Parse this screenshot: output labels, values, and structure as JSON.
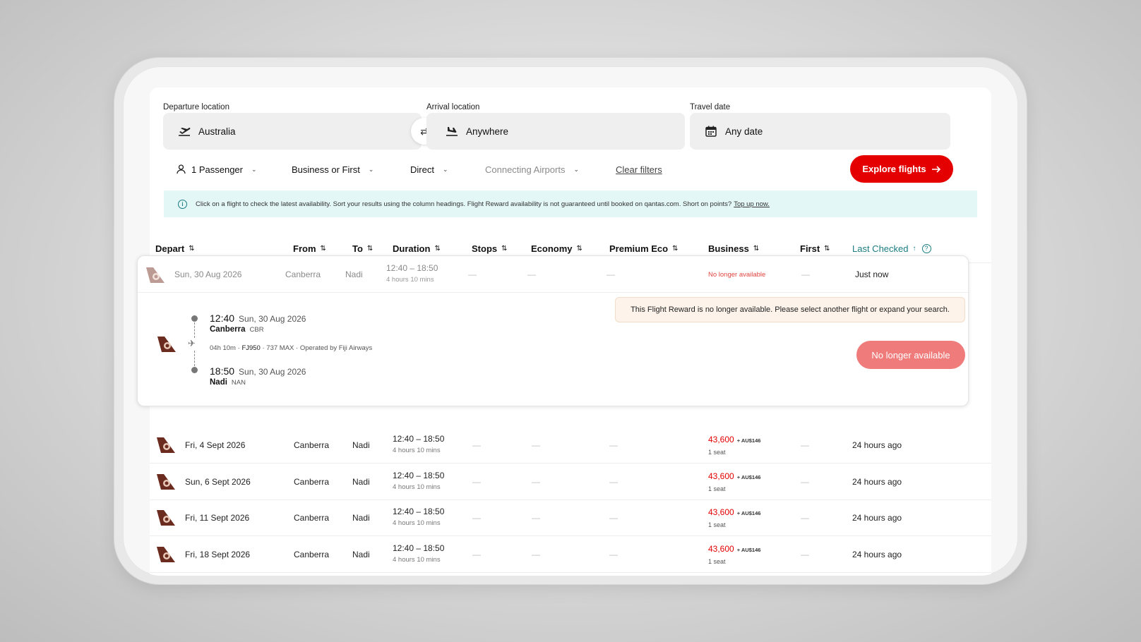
{
  "search": {
    "departure_label": "Departure location",
    "departure_value": "Australia",
    "arrival_label": "Arrival location",
    "arrival_value": "Anywhere",
    "date_label": "Travel date",
    "date_value": "Any date"
  },
  "filters": {
    "passengers": "1 Passenger",
    "cabin": "Business or First",
    "stops": "Direct",
    "connecting": "Connecting Airports",
    "clear": "Clear filters",
    "explore": "Explore flights"
  },
  "banner": {
    "text": "Click on a flight to check the latest availability. Sort your results using the column headings. Flight Reward availability is not guaranteed until booked on qantas.com. Short on points?",
    "link": "Top up now."
  },
  "columns": {
    "depart": "Depart",
    "from": "From",
    "to": "To",
    "duration": "Duration",
    "stops": "Stops",
    "economy": "Economy",
    "premium": "Premium Eco",
    "business": "Business",
    "first": "First",
    "last_checked": "Last Checked"
  },
  "selected": {
    "date": "Sun, 30 Aug 2026",
    "from": "Canberra",
    "to": "Nadi",
    "time": "12:40 – 18:50",
    "duration": "4 hours 10 mins",
    "dash": "—",
    "business": "No longer available",
    "last_checked": "Just now",
    "dep_time": "12:40",
    "dep_date": "Sun, 30 Aug 2026",
    "dep_city": "Canberra",
    "dep_code": "CBR",
    "meta_duration": "04h 10m",
    "meta_flight": "FJ950",
    "meta_aircraft": "737 MAX",
    "meta_operator": "Operated by Fiji Airways",
    "arr_time": "18:50",
    "arr_date": "Sun, 30 Aug 2026",
    "arr_city": "Nadi",
    "arr_code": "NAN",
    "alert": "This Flight Reward is no longer available. Please select another flight or expand your search.",
    "button": "No longer available"
  },
  "rows": [
    {
      "date": "Fri, 4 Sept 2026",
      "from": "Canberra",
      "to": "Nadi",
      "time": "12:40 – 18:50",
      "duration": "4 hours 10 mins",
      "dash": "—",
      "price": "43,600",
      "tax": "+ AU$146",
      "seats": "1 seat",
      "last_checked": "24 hours ago"
    },
    {
      "date": "Sun, 6 Sept 2026",
      "from": "Canberra",
      "to": "Nadi",
      "time": "12:40 – 18:50",
      "duration": "4 hours 10 mins",
      "dash": "—",
      "price": "43,600",
      "tax": "+ AU$146",
      "seats": "1 seat",
      "last_checked": "24 hours ago"
    },
    {
      "date": "Fri, 11 Sept 2026",
      "from": "Canberra",
      "to": "Nadi",
      "time": "12:40 – 18:50",
      "duration": "4 hours 10 mins",
      "dash": "—",
      "price": "43,600",
      "tax": "+ AU$146",
      "seats": "1 seat",
      "last_checked": "24 hours ago"
    },
    {
      "date": "Fri, 18 Sept 2026",
      "from": "Canberra",
      "to": "Nadi",
      "time": "12:40 – 18:50",
      "duration": "4 hours 10 mins",
      "dash": "—",
      "price": "43,600",
      "tax": "+ AU$146",
      "seats": "1 seat",
      "last_checked": "24 hours ago"
    }
  ],
  "icons": {
    "departure": "plane-takeoff-icon",
    "arrival": "plane-landing-icon",
    "date": "calendar-icon",
    "swap": "swap-icon",
    "passenger": "user-icon",
    "info": "info-icon",
    "help": "question-icon",
    "airline": "fiji-airways-tail-icon",
    "arrow": "arrow-right-icon"
  },
  "colors": {
    "brand_red": "#e40000",
    "teal": "#1b7b82",
    "banner_bg": "#e3f7f6",
    "alert_bg": "#fdf3ea",
    "disabled_button": "#ef7b7b"
  }
}
